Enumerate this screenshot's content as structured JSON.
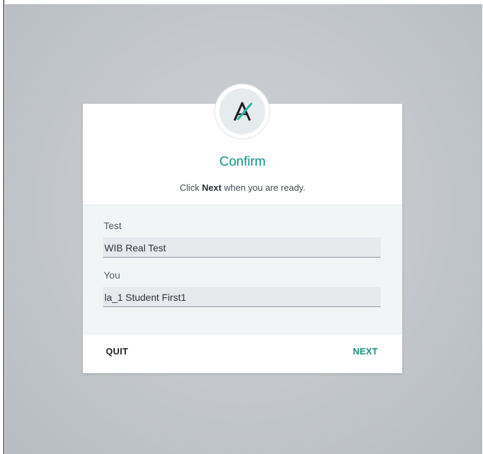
{
  "dialog": {
    "title": "Confirm",
    "subtitle_prefix": "Click ",
    "subtitle_bold": "Next",
    "subtitle_suffix": " when you are ready."
  },
  "fields": [
    {
      "label": "Test",
      "value": "WIB Real Test"
    },
    {
      "label": "You",
      "value": "la_1 Student First1"
    }
  ],
  "actions": {
    "quit_label": "QUIT",
    "next_label": "NEXT"
  },
  "colors": {
    "accent": "#0f9286",
    "background": "#c3c7cc",
    "card": "#ffffff",
    "field_area": "#f1f5f6"
  },
  "icons": {
    "logo": "stylized-a-check-logo"
  }
}
